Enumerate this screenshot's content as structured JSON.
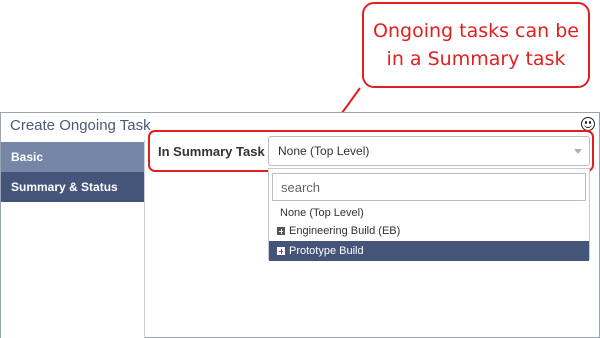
{
  "callout": {
    "line1": "Ongoing tasks can be",
    "line2": "in a Summary task"
  },
  "window": {
    "title": "Create Ongoing Task",
    "icon": "smiley-icon"
  },
  "sidebar": {
    "items": [
      {
        "label": "Basic"
      },
      {
        "label": "Summary & Status"
      }
    ]
  },
  "field": {
    "label": "In Summary Task",
    "selected_value": "None (Top Level)"
  },
  "dropdown": {
    "search_placeholder": "search",
    "options": [
      {
        "label": "None (Top Level)"
      },
      {
        "label": "Engineering Build (EB)"
      },
      {
        "label": "Prototype Build"
      }
    ]
  },
  "colors": {
    "callout_red": "#e02020",
    "sidebar_basic": "#7586a6",
    "sidebar_active": "#45557a",
    "option_highlight": "#45557a"
  }
}
